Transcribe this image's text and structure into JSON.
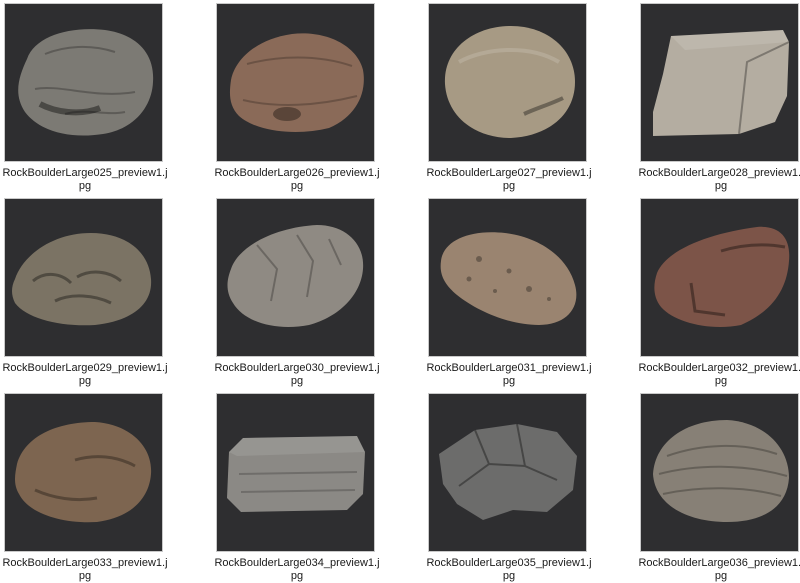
{
  "files": [
    {
      "name": "RockBoulderLarge025_preview1.jpg",
      "stone": "grey-rounded",
      "color": "#7c7a74"
    },
    {
      "name": "RockBoulderLarge026_preview1.jpg",
      "stone": "reddish-flat",
      "color": "#8a6a58"
    },
    {
      "name": "RockBoulderLarge027_preview1.jpg",
      "stone": "tan-egg",
      "color": "#a79a84"
    },
    {
      "name": "RockBoulderLarge028_preview1.jpg",
      "stone": "pale-block",
      "color": "#b4ada1"
    },
    {
      "name": "RockBoulderLarge029_preview1.jpg",
      "stone": "olive-wide",
      "color": "#7b7364"
    },
    {
      "name": "RockBoulderLarge030_preview1.jpg",
      "stone": "grey-slab",
      "color": "#8f8a83"
    },
    {
      "name": "RockBoulderLarge031_preview1.jpg",
      "stone": "speckled-tan",
      "color": "#9a8470"
    },
    {
      "name": "RockBoulderLarge032_preview1.jpg",
      "stone": "red-angular",
      "color": "#7c5448"
    },
    {
      "name": "RockBoulderLarge033_preview1.jpg",
      "stone": "brown-round",
      "color": "#7d6550"
    },
    {
      "name": "RockBoulderLarge034_preview1.jpg",
      "stone": "grey-flat-top",
      "color": "#8b8985"
    },
    {
      "name": "RockBoulderLarge035_preview1.jpg",
      "stone": "dark-grey-jagged",
      "color": "#6c6c6b"
    },
    {
      "name": "RockBoulderLarge036_preview1.jpg",
      "stone": "striated-dome",
      "color": "#878076"
    }
  ]
}
